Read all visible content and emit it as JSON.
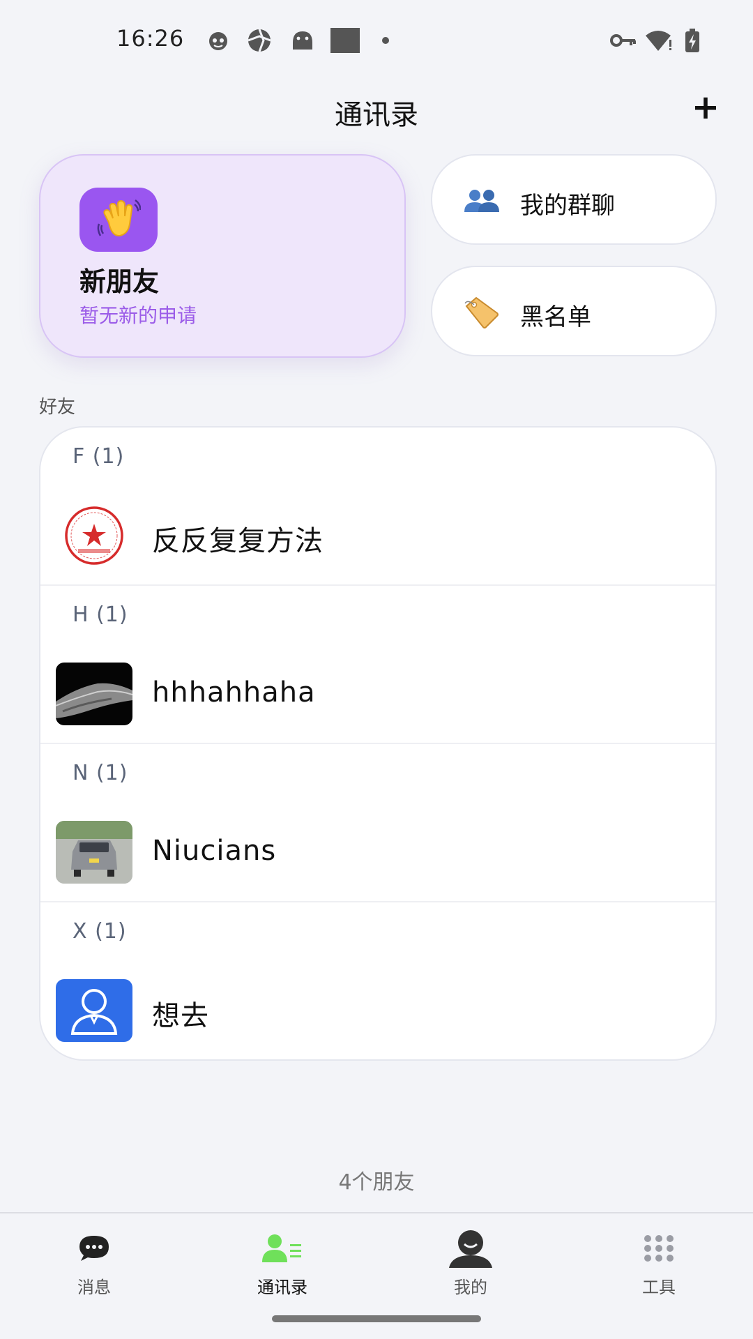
{
  "status_bar": {
    "time": "16:26"
  },
  "header": {
    "title": "通讯录",
    "add_label": "+"
  },
  "new_friends": {
    "title": "新朋友",
    "subtitle": "暂无新的申请",
    "icon": "waving-hand-icon"
  },
  "quick_links": [
    {
      "label": "我的群聊",
      "icon": "group-icon"
    },
    {
      "label": "黑名单",
      "icon": "tag-icon"
    }
  ],
  "friends_section": {
    "label": "好友",
    "groups": [
      {
        "header": "F (1)",
        "contact": "反反复复方法",
        "avatar": "stamp-seal-avatar"
      },
      {
        "header": "H (1)",
        "contact": "hhhahhaha",
        "avatar": "dark-landscape-avatar"
      },
      {
        "header": "N (1)",
        "contact": "Niucians",
        "avatar": "car-photo-avatar"
      },
      {
        "header": "X (1)",
        "contact": "想去",
        "avatar": "default-user-avatar"
      }
    ]
  },
  "footer": {
    "friend_count": "4个朋友"
  },
  "bottom_nav": {
    "items": [
      {
        "label": "消息",
        "icon": "chat-bubble-icon"
      },
      {
        "label": "通讯录",
        "icon": "contacts-icon",
        "active": true
      },
      {
        "label": "我的",
        "icon": "profile-icon"
      },
      {
        "label": "工具",
        "icon": "grid-icon"
      }
    ]
  },
  "colors": {
    "background": "#f3f4f8",
    "accent_purple": "#9a56f0",
    "nav_active_green": "#6fe05a",
    "avatar_blue": "#2f6de8"
  }
}
